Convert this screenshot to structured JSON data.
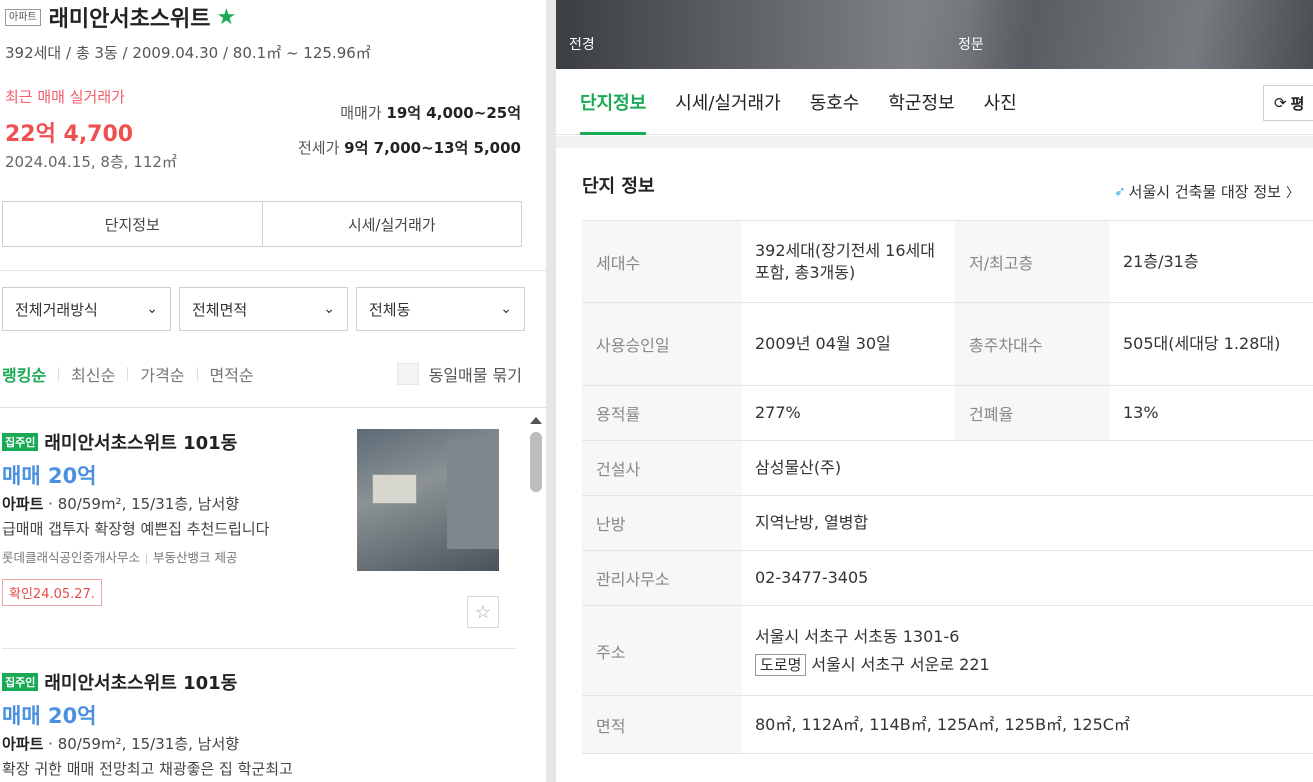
{
  "complex": {
    "type_badge": "아파트",
    "name": "래미안서초스위트",
    "star": "★",
    "summary": "392세대 / 총 3동 / 2009.04.30 / 80.1㎡ ~ 125.96㎡"
  },
  "recent": {
    "label": "최근 매매 실거래가",
    "price": "22억 4,700",
    "date": "2024.04.15, 8층, 112㎡"
  },
  "price_ranges": {
    "sale_label": "매매가",
    "sale_value": "19억 4,000~25억",
    "jeonse_label": "전세가",
    "jeonse_value": "9억 7,000~13억 5,000"
  },
  "left_tabs": [
    "단지정보",
    "시세/실거래가"
  ],
  "filters": [
    "전체거래방식",
    "전체면적",
    "전체동"
  ],
  "sort": {
    "items": [
      "랭킹순",
      "최신순",
      "가격순",
      "면적순"
    ],
    "bundle_label": "동일매물 묶기"
  },
  "listings": [
    {
      "badge": "집주인",
      "name": "래미안서초스위트 101동",
      "price": "매매 20억",
      "spec_type": "아파트",
      "spec_rest": " · 80/59m², 15/31층, 남서향",
      "desc": "급매매 갭투자 확장형 예쁜집 추천드립니다",
      "broker": "롯데클래식공인중개사무소",
      "provider": "부동산뱅크 제공",
      "confirm": "확인24.05.27."
    },
    {
      "badge": "집주인",
      "name": "래미안서초스위트 101동",
      "price": "매매 20억",
      "spec_type": "아파트",
      "spec_rest": " · 80/59m², 15/31층, 남서향",
      "desc": "확장 귀한 매매 전망최고 채광좋은 집 학군최고"
    }
  ],
  "photos": [
    "전경",
    "정문"
  ],
  "right_tabs": [
    "단지정보",
    "시세/실거래가",
    "동호수",
    "학군정보",
    "사진"
  ],
  "pyeong_label": "평",
  "info": {
    "title": "단지 정보",
    "link": "서울시 건축물 대장 정보",
    "households_label": "세대수",
    "households_value": "392세대(장기전세 16세대 포함, 총3개동)",
    "floors_label": "저/최고층",
    "floors_value": "21층/31층",
    "approval_label": "사용승인일",
    "approval_value": "2009년 04월 30일",
    "parking_label": "총주차대수",
    "parking_value": "505대(세대당 1.28대)",
    "far_label": "용적률",
    "far_value": "277%",
    "bcr_label": "건폐율",
    "bcr_value": "13%",
    "builder_label": "건설사",
    "builder_value": "삼성물산(주)",
    "heating_label": "난방",
    "heating_value": "지역난방, 열병합",
    "office_label": "관리사무소",
    "office_value": "02-3477-3405",
    "address_label": "주소",
    "address_value": "서울시 서초구 서초동 1301-6",
    "road_tag": "도로명",
    "road_value": "서울시 서초구 서운로 221",
    "area_label": "면적",
    "area_value": "80㎡, 112A㎡, 114B㎡, 125A㎡, 125B㎡, 125C㎡"
  }
}
